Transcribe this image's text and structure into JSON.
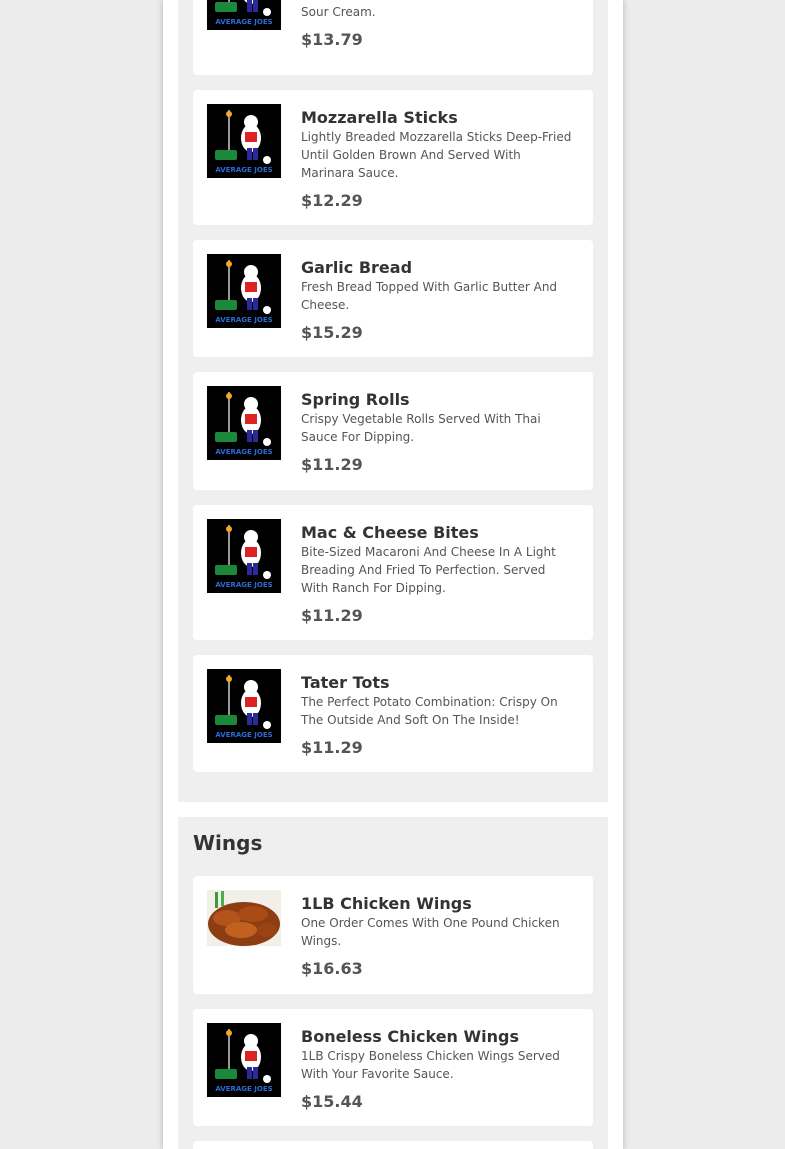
{
  "sections": [
    {
      "title": "",
      "items": [
        {
          "name": "",
          "description": "Tasty Potato Shells Loaded With Cheese Bacon Bits And Fresh Chives, Served With Sour Cream.",
          "price": "$13.79",
          "image": "restaurant-logo-icon"
        },
        {
          "name": "Mozzarella Sticks",
          "description": "Lightly Breaded Mozzarella Sticks Deep-Fried Until Golden Brown And Served With Marinara Sauce.",
          "price": "$12.29",
          "image": "restaurant-logo-icon"
        },
        {
          "name": "Garlic Bread",
          "description": "Fresh Bread Topped With Garlic Butter And Cheese.",
          "price": "$15.29",
          "image": "restaurant-logo-icon"
        },
        {
          "name": "Spring Rolls",
          "description": "Crispy Vegetable Rolls Served With Thai Sauce For Dipping.",
          "price": "$11.29",
          "image": "restaurant-logo-icon"
        },
        {
          "name": "Mac & Cheese Bites",
          "description": "Bite-Sized Macaroni And Cheese In A Light Breading And Fried To Perfection. Served With Ranch For Dipping.",
          "price": "$11.29",
          "image": "restaurant-logo-icon"
        },
        {
          "name": "Tater Tots",
          "description": "The Perfect Potato Combination: Crispy On The Outside And Soft On The Inside!",
          "price": "$11.29",
          "image": "restaurant-logo-icon"
        }
      ]
    },
    {
      "title": "Wings",
      "items": [
        {
          "name": "1LB Chicken Wings",
          "description": "One Order Comes With One Pound Chicken Wings.",
          "price": "$16.63",
          "image": "chicken-wings-photo"
        },
        {
          "name": "Boneless Chicken Wings",
          "description": "1LB Crispy Boneless Chicken Wings Served With Your Favorite Sauce.",
          "price": "$15.44",
          "image": "restaurant-logo-icon"
        }
      ]
    }
  ],
  "colors": {
    "page_background": "#ececec",
    "section_background": "#efefef",
    "card_background": "#ffffff",
    "text_dark": "#333333",
    "text_muted": "#555555",
    "logo_blue": "#2a6cd6"
  }
}
